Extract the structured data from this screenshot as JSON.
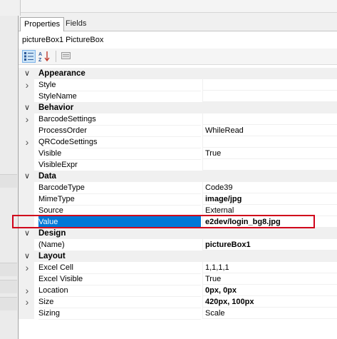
{
  "tabs": [
    {
      "label": "Properties",
      "active": true
    },
    {
      "label": "Fields",
      "active": false
    }
  ],
  "object_label": "pictureBox1 PictureBox",
  "toolbar": {
    "categorized_icon": "categorized-view-icon",
    "alphabetical_icon": "alphabetical-sort-icon",
    "property_pages_icon": "property-pages-icon"
  },
  "properties": [
    {
      "type": "category",
      "name": "Appearance"
    },
    {
      "type": "prop",
      "name": "Style",
      "value": "",
      "expandable": true
    },
    {
      "type": "prop",
      "name": "StyleName",
      "value": ""
    },
    {
      "type": "category",
      "name": "Behavior"
    },
    {
      "type": "prop",
      "name": "BarcodeSettings",
      "value": "",
      "expandable": true
    },
    {
      "type": "prop",
      "name": "ProcessOrder",
      "value": "WhileRead"
    },
    {
      "type": "prop",
      "name": "QRCodeSettings",
      "value": "",
      "expandable": true
    },
    {
      "type": "prop",
      "name": "Visible",
      "value": "True"
    },
    {
      "type": "prop",
      "name": "VisibleExpr",
      "value": ""
    },
    {
      "type": "category",
      "name": "Data"
    },
    {
      "type": "prop",
      "name": "BarcodeType",
      "value": "Code39"
    },
    {
      "type": "prop",
      "name": "MimeType",
      "value": "image/jpg",
      "bold": true
    },
    {
      "type": "prop",
      "name": "Source",
      "value": "External"
    },
    {
      "type": "prop",
      "name": "Value",
      "value": "e2dev/login_bg8.jpg",
      "bold": true,
      "selected": true
    },
    {
      "type": "category",
      "name": "Design"
    },
    {
      "type": "prop",
      "name": "(Name)",
      "value": "pictureBox1",
      "bold": true
    },
    {
      "type": "category",
      "name": "Layout"
    },
    {
      "type": "prop",
      "name": "Excel Cell",
      "value": "1,1,1,1",
      "expandable": true
    },
    {
      "type": "prop",
      "name": "Excel Visible",
      "value": "True"
    },
    {
      "type": "prop",
      "name": "Location",
      "value": "0px, 0px",
      "bold": true,
      "expandable": true
    },
    {
      "type": "prop",
      "name": "Size",
      "value": "420px, 100px",
      "bold": true,
      "expandable": true
    },
    {
      "type": "prop",
      "name": "Sizing",
      "value": "Scale"
    }
  ],
  "colors": {
    "selection": "#0078d7",
    "highlight_border": "#d0021b"
  }
}
